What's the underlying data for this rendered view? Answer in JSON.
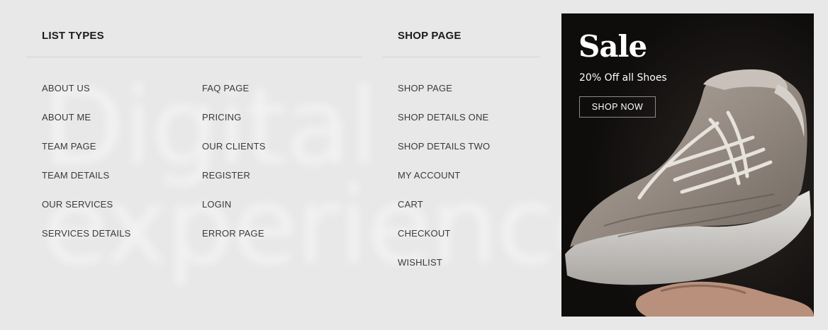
{
  "menu": {
    "list_types": {
      "heading": "LIST TYPES",
      "col1": [
        "ABOUT US",
        "ABOUT ME",
        "TEAM PAGE",
        "TEAM DETAILS",
        "OUR SERVICES",
        "SERVICES DETAILS"
      ],
      "col2": [
        "FAQ PAGE",
        "PRICING",
        "OUR CLIENTS",
        "REGISTER",
        "LOGIN",
        "ERROR PAGE"
      ]
    },
    "shop_page": {
      "heading": "SHOP PAGE",
      "items": [
        "SHOP PAGE",
        "SHOP DETAILS ONE",
        "SHOP DETAILS TWO",
        "MY ACCOUNT",
        "CART",
        "CHECKOUT",
        "WISHLIST"
      ]
    }
  },
  "promo": {
    "title": "Sale",
    "subtitle": "20% Off all Shoes",
    "button_label": "SHOP NOW"
  },
  "background_text": "Digital\nexperiences",
  "colors": {
    "page_bg": "#e8e8e8",
    "promo_bg": "#0f0d0c",
    "text": "#222222"
  }
}
